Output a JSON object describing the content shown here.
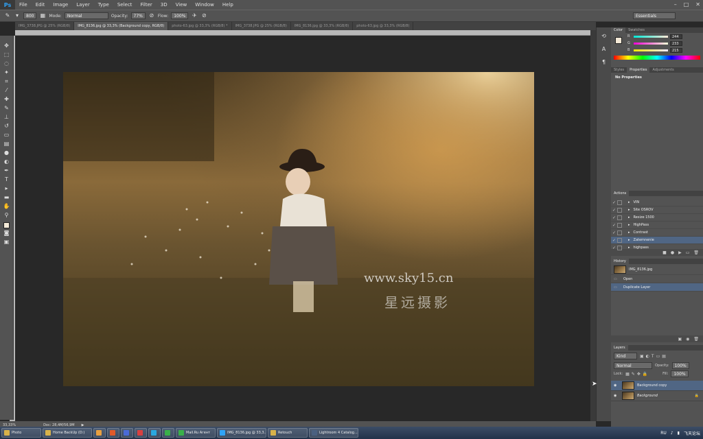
{
  "menubar": {
    "logo": "Ps",
    "items": [
      "File",
      "Edit",
      "Image",
      "Layer",
      "Type",
      "Select",
      "Filter",
      "3D",
      "View",
      "Window",
      "Help"
    ],
    "window_controls": [
      "–",
      "□",
      "✕"
    ]
  },
  "options": {
    "brush_size": "800",
    "mode_label": "Mode:",
    "mode_value": "Normal",
    "opacity_label": "Opacity:",
    "opacity_value": "77%",
    "flow_label": "Flow:",
    "flow_value": "100%",
    "workspace": "Essentials"
  },
  "doc_tabs": [
    {
      "label": "IMG_3738.JPG @ 25% (RGB/8)",
      "active": false
    },
    {
      "label": "IMG_8136.jpg @ 33,3% (Background copy, RGB/8)",
      "active": true
    },
    {
      "label": "photo-63.jpg @ 33,3% (RGB/8) *",
      "active": false
    },
    {
      "label": "IMG_3738.JPG @ 25% (RGB/8)",
      "active": false
    },
    {
      "label": "IMG_8136.jpg @ 33,3% (RGB/8)",
      "active": false
    },
    {
      "label": "photo-63.jpg @ 33,3% (RGB/8)",
      "active": false
    }
  ],
  "canvas": {
    "watermark_url": "www.sky15.cn",
    "watermark_cn": "星远摄影"
  },
  "status": {
    "zoom": "33,33%",
    "doc": "Doc: 28,4M/56,9M"
  },
  "color_panel": {
    "tabs": [
      "Color",
      "Swatches"
    ],
    "r_label": "R",
    "r_value": "244",
    "g_label": "G",
    "g_value": "233",
    "b_label": "B",
    "b_value": "215"
  },
  "properties_panel": {
    "tabs": [
      "Styles",
      "Properties",
      "Adjustments"
    ],
    "content": "No Properties"
  },
  "actions_panel": {
    "title": "Actions",
    "items": [
      {
        "label": "VIN",
        "selected": false
      },
      {
        "label": "Site OSROV",
        "selected": false
      },
      {
        "label": "Resize 1500",
        "selected": false
      },
      {
        "label": "HighPass",
        "selected": false
      },
      {
        "label": "Contrast",
        "selected": false
      },
      {
        "label": "Zatemnenie",
        "selected": true
      },
      {
        "label": "highpass",
        "selected": false
      }
    ]
  },
  "history_panel": {
    "title": "History",
    "snapshot": "IMG_8136.jpg",
    "items": [
      {
        "label": "Open",
        "selected": false
      },
      {
        "label": "Duplicate Layer",
        "selected": true
      }
    ]
  },
  "layers_panel": {
    "title": "Layers",
    "kind": "Kind",
    "blend": "Normal",
    "opacity_label": "Opacity:",
    "opacity_value": "100%",
    "lock_label": "Lock:",
    "fill_label": "Fill:",
    "fill_value": "100%",
    "layers": [
      {
        "label": "Background copy",
        "selected": true
      },
      {
        "label": "Background",
        "selected": false
      }
    ]
  },
  "taskbar": {
    "items": [
      {
        "label": "Photo",
        "color": "#d8b24a"
      },
      {
        "label": "Home BackUp (D:)",
        "color": "#d8b24a"
      },
      {
        "label": "",
        "color": "#e8a040"
      },
      {
        "label": "",
        "color": "#e05a2a"
      },
      {
        "label": "",
        "color": "#4a6ad8"
      },
      {
        "label": "",
        "color": "#d84040"
      },
      {
        "label": "",
        "color": "#2aa8e0"
      },
      {
        "label": "",
        "color": "#3ab04a"
      },
      {
        "label": "Mail.Ru Агент",
        "color": "#3ab04a"
      },
      {
        "label": "IMG_8136.jpg @ 33,3...",
        "color": "#2fa3f7"
      },
      {
        "label": "Retouch",
        "color": "#d8b24a"
      },
      {
        "label": "Lightroom 4 Catalog...",
        "color": "#4a6080"
      }
    ],
    "lang": "RU",
    "tray_text": "飞天论坛"
  },
  "colors": {
    "accent": "#506684",
    "ui_gray": "#535353",
    "canvas_bg": "#282828"
  }
}
